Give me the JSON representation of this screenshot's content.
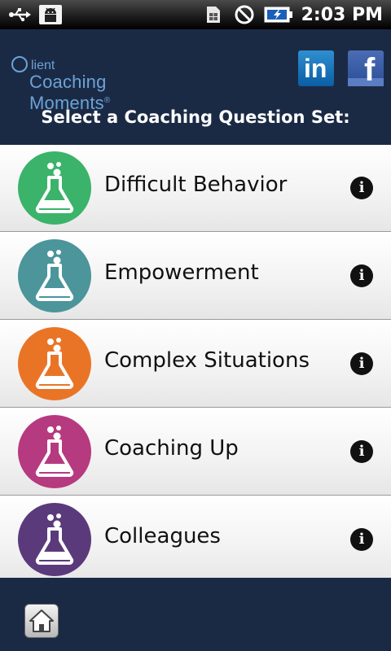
{
  "status_bar": {
    "time": "2:03 PM",
    "left_icons": [
      "usb-icon",
      "android-debug-icon"
    ],
    "right_icons": [
      "sim-card-icon",
      "no-signal-icon",
      "battery-charging-icon"
    ]
  },
  "header": {
    "logo_client": "lient",
    "logo_c": "C",
    "logo_title": "Coaching Moments",
    "logo_reg": "®",
    "linkedin_label": "in",
    "facebook_label": "f",
    "prompt": "Select a Coaching Question Set:"
  },
  "question_sets": [
    {
      "label": "Difficult Behavior",
      "color": "#3bb36a",
      "icon": "flask-icon",
      "info": "i"
    },
    {
      "label": "Empowerment",
      "color": "#4b959b",
      "icon": "flask-icon",
      "info": "i"
    },
    {
      "label": "Complex Situations",
      "color": "#ea7426",
      "icon": "flask-icon",
      "info": "i"
    },
    {
      "label": "Coaching Up",
      "color": "#b63a80",
      "icon": "flask-icon",
      "info": "i"
    },
    {
      "label": "Colleagues",
      "color": "#5b3a7b",
      "icon": "flask-icon",
      "info": "i"
    }
  ],
  "footer": {
    "home_icon": "home-icon"
  }
}
